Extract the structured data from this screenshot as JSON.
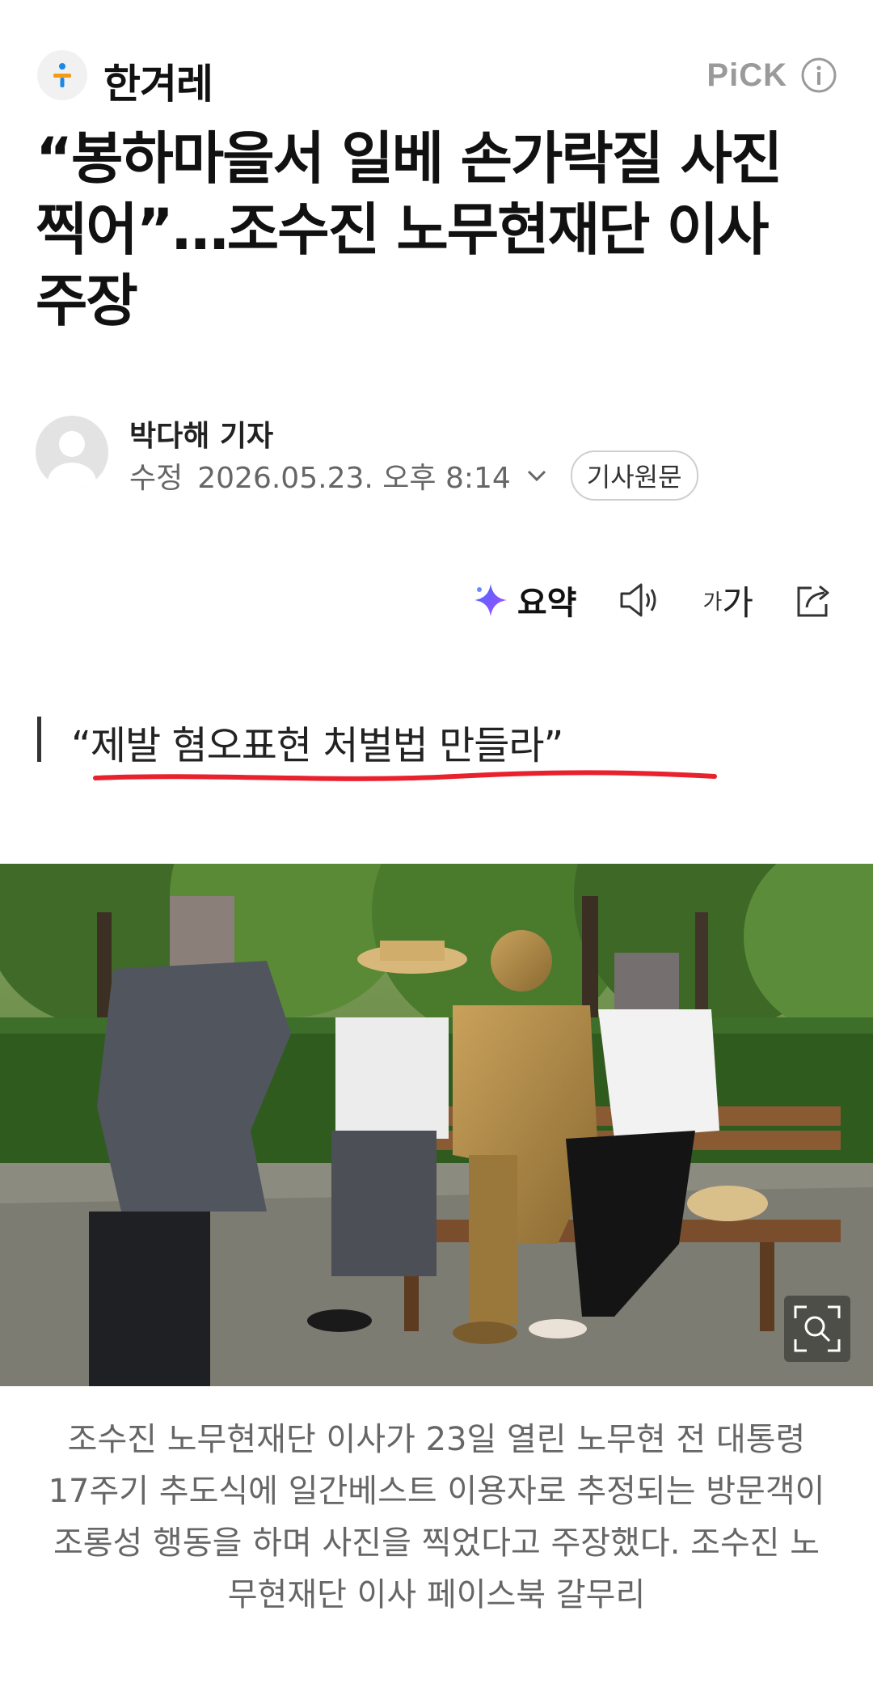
{
  "press": {
    "name": "한겨레",
    "logo_icon": "hankyoreh-logo-icon"
  },
  "badge": {
    "label": "PiCK",
    "icon": "info-icon"
  },
  "article": {
    "headline": "“봉하마을서 일베 손가락질 사진 찍어”…조수진 노무현재단 이사 주장",
    "reporter": "박다해 기자",
    "modified_label": "수정",
    "datetime": "2026.05.23. 오후 8:14",
    "original_button": "기사원문",
    "subtitle": "“제발 혐오표현 처벌법 만들라”",
    "caption": "조수진 노무현재단 이사가 23일 열린 노무현 전 대통령 17주기 추도식에 일간베스트 이용자로 추정되는 방문객이 조롱성 행동을 하며 사진을 찍었다고 주장했다. 조수진 노무현재단 이사 페이스북 갈무리"
  },
  "toolbar": {
    "summary_label": "요약",
    "font_small": "가",
    "font_large": "가"
  },
  "colors": {
    "accent_red": "#e8212d",
    "text_gray": "#666666",
    "pick_gray": "#9a9a9a"
  }
}
